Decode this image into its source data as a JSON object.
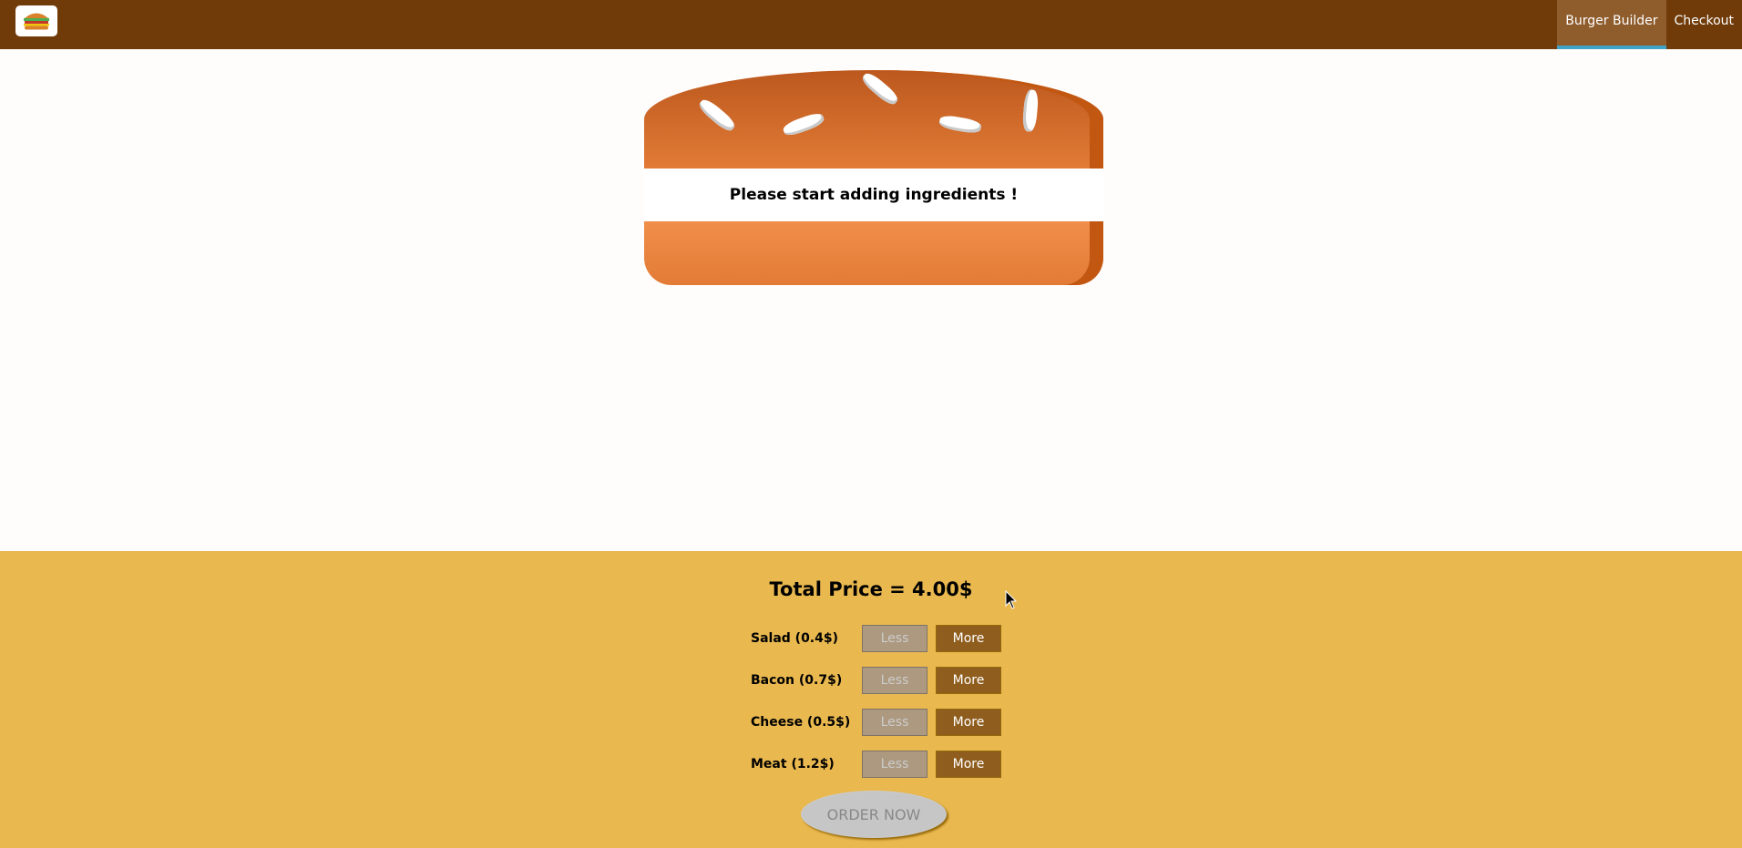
{
  "toolbar": {
    "logo_icon": "burger-logo-icon",
    "nav": [
      {
        "label": "Burger Builder",
        "active": true
      },
      {
        "label": "Checkout",
        "active": false
      }
    ]
  },
  "burger": {
    "empty_message": "Please start adding ingredients !"
  },
  "build_controls": {
    "total_price": "Total Price = 4.00$",
    "ingredients": [
      {
        "label": "Salad (0.4$)",
        "less": "Less",
        "more": "More"
      },
      {
        "label": "Bacon (0.7$)",
        "less": "Less",
        "more": "More"
      },
      {
        "label": "Cheese (0.5$)",
        "less": "Less",
        "more": "More"
      },
      {
        "label": "Meat (1.2$)",
        "less": "Less",
        "more": "More"
      }
    ],
    "order_button": "ORDER NOW"
  },
  "colors": {
    "toolbar": "#703b09",
    "controls_bg": "#e9b84f",
    "more_button": "#8f5e1e",
    "active_nav_underline": "#40a4c8"
  }
}
